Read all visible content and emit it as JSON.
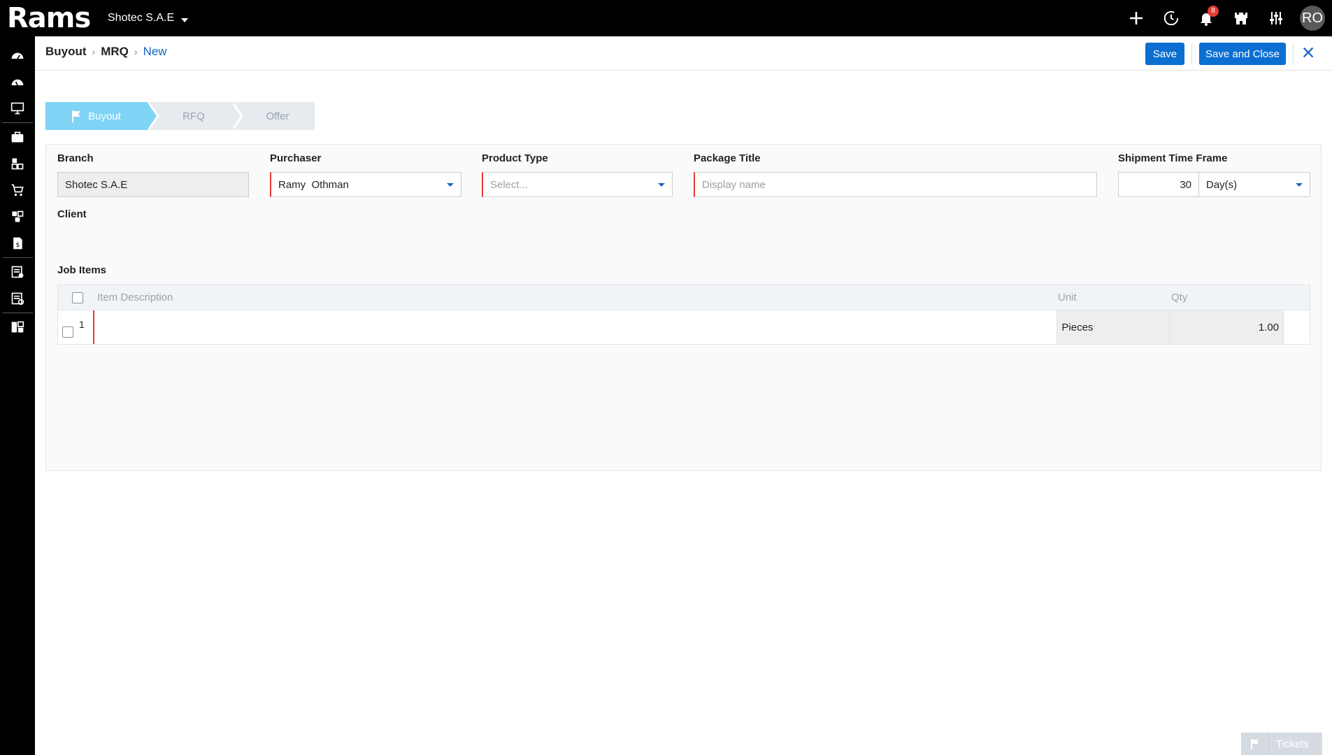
{
  "app": {
    "logo_text": "Rams",
    "company": "Shotec S.A.E"
  },
  "topbar": {
    "notifications_count": "8",
    "avatar_initials": "RO"
  },
  "sidebar": {
    "items": [
      "dashboard-icon",
      "dashboard-icon",
      "monitor-icon",
      "briefcase-icon",
      "modules-icon",
      "cart-icon",
      "modules-icon",
      "invoice-icon",
      "checklist-icon",
      "settings-doc-icon",
      "grid-icon"
    ]
  },
  "header": {
    "breadcrumb": [
      "Buyout",
      "MRQ",
      "New"
    ],
    "save_label": "Save",
    "save_close_label": "Save and Close"
  },
  "stepper": {
    "steps": [
      "Buyout",
      "RFQ",
      "Offer"
    ],
    "active": 0
  },
  "form": {
    "branch": {
      "label": "Branch",
      "value": "Shotec S.A.E"
    },
    "purchaser": {
      "label": "Purchaser",
      "value": "Ramy  Othman"
    },
    "product_type": {
      "label": "Product Type",
      "placeholder": "Select..."
    },
    "package_title": {
      "label": "Package Title",
      "placeholder": "Display name"
    },
    "shipment": {
      "label": "Shipment Time Frame",
      "value": "30",
      "unit": "Day(s)"
    },
    "client": {
      "label": "Client"
    },
    "job_items": {
      "label": "Job Items",
      "columns": [
        "Item Description",
        "Unit",
        "Qty"
      ],
      "rows": [
        {
          "index": "1",
          "description": "",
          "unit": "Pieces",
          "qty": "1.00"
        }
      ]
    }
  },
  "footer": {
    "tickets_label": "Tickets"
  },
  "colors": {
    "accent": "#0b6fd1",
    "active_step": "#7fd3f5",
    "required": "#e53935"
  }
}
